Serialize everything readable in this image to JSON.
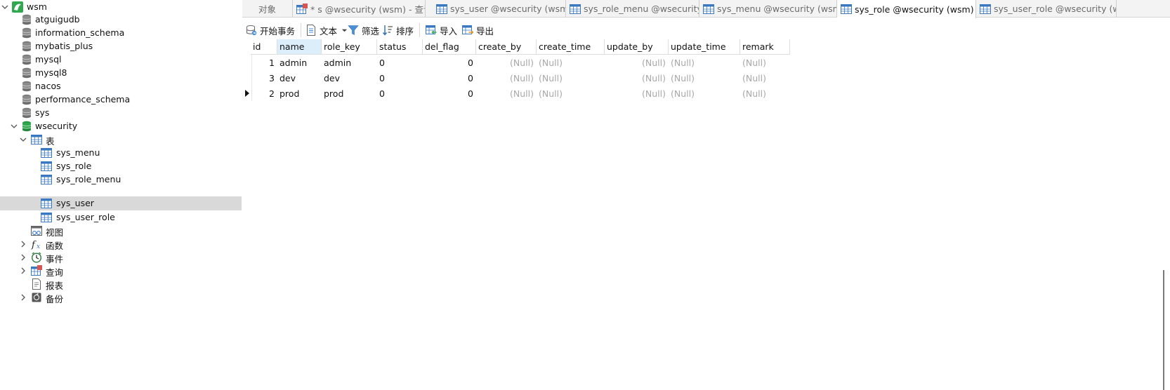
{
  "tree": {
    "connection": "wsm",
    "databases": [
      "atguigudb",
      "information_schema",
      "mybatis_plus",
      "mysql",
      "mysql8",
      "nacos",
      "performance_schema",
      "sys"
    ],
    "active_db": "wsecurity",
    "tables_folder": "表",
    "tables": [
      "sys_menu",
      "sys_role",
      "sys_role_menu",
      "sys_user",
      "sys_user_role"
    ],
    "selected_table": "sys_user",
    "views": "视图",
    "functions": "函数",
    "events": "事件",
    "queries": "查询",
    "reports": "报表",
    "backups": "备份"
  },
  "tabs": [
    {
      "label": "对象",
      "icon": "none"
    },
    {
      "label": "* s @wsecurity (wsm) - 查询",
      "icon": "query-icon"
    },
    {
      "label": "sys_user @wsecurity (wsm) ...",
      "icon": "table-icon"
    },
    {
      "label": "sys_role_menu @wsecurity (...",
      "icon": "table-icon"
    },
    {
      "label": "sys_menu @wsecurity (wsm)...",
      "icon": "table-icon"
    },
    {
      "label": "sys_role @wsecurity (wsm) -...",
      "icon": "table-icon",
      "active": true
    },
    {
      "label": "sys_user_role @wsecurity (w...",
      "icon": "table-icon"
    }
  ],
  "toolbar": {
    "begin_transaction": "开始事务",
    "text": "文本",
    "filter": "筛选",
    "sort": "排序",
    "import": "导入",
    "export": "导出"
  },
  "grid": {
    "columns": [
      "id",
      "name",
      "role_key",
      "status",
      "del_flag",
      "create_by",
      "create_time",
      "update_by",
      "update_time",
      "remark"
    ],
    "selected_column": "name",
    "rows": [
      {
        "id": "1",
        "name": "admin",
        "role_key": "admin",
        "status": "0",
        "del_flag": "0",
        "create_by": "(Null)",
        "create_time": "(Null)",
        "update_by": "(Null)",
        "update_time": "(Null)",
        "remark": "(Null)"
      },
      {
        "id": "3",
        "name": "dev",
        "role_key": "dev",
        "status": "0",
        "del_flag": "0",
        "create_by": "(Null)",
        "create_time": "(Null)",
        "update_by": "(Null)",
        "update_time": "(Null)",
        "remark": "(Null)"
      },
      {
        "id": "2",
        "name": "prod",
        "role_key": "prod",
        "status": "0",
        "del_flag": "0",
        "create_by": "(Null)",
        "create_time": "(Null)",
        "update_by": "(Null)",
        "update_time": "(Null)",
        "remark": "(Null)",
        "current": true
      }
    ]
  },
  "colors": {
    "selected_row": "#d9d9d9",
    "selected_header": "#ddeefb",
    "null_text": "#a8a8a8",
    "active_db_icon": "#2fa84f",
    "connection_icon": "#2fa84f"
  }
}
